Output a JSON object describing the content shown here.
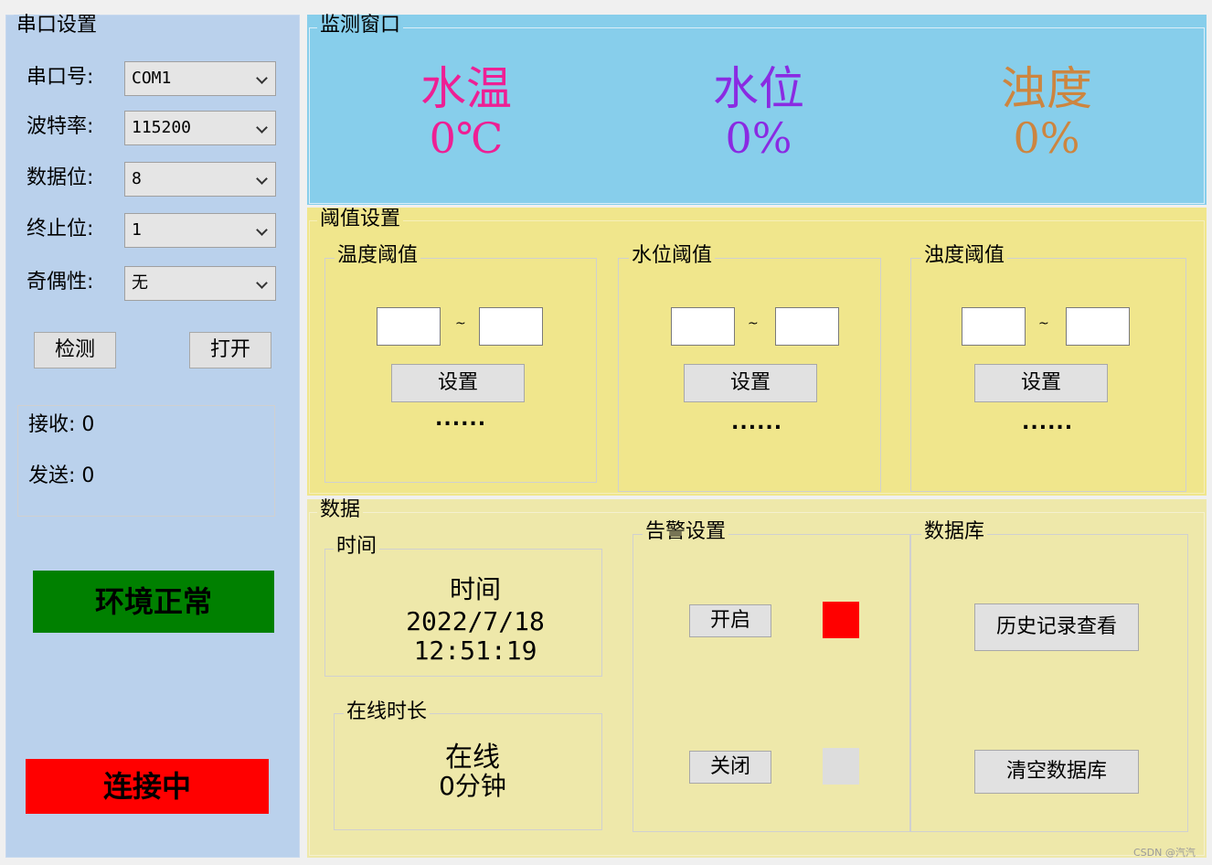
{
  "serial": {
    "title": "串口设置",
    "fields": [
      {
        "label": "串口号:",
        "value": "COM1"
      },
      {
        "label": "波特率:",
        "value": "115200"
      },
      {
        "label": "数据位:",
        "value": "8"
      },
      {
        "label": "终止位:",
        "value": "1"
      },
      {
        "label": "奇偶性:",
        "value": "无"
      }
    ],
    "detect_label": "检测",
    "open_label": "打开",
    "receive_text": "接收: 0",
    "send_text": "发送: 0",
    "env_status": "环境正常",
    "conn_status": "连接中",
    "colors": {
      "panel": "#bad1ec",
      "env_status_bg": "#008000",
      "conn_status_bg": "#ff0000"
    }
  },
  "monitor": {
    "title": "监测窗口",
    "items": [
      {
        "name": "水温",
        "value": "0℃",
        "color": "#ee1f94"
      },
      {
        "name": "水位",
        "value": "0%",
        "color": "#8a2be2"
      },
      {
        "name": "浊度",
        "value": "0%",
        "color": "#cd853f"
      }
    ],
    "bg_color": "#87ceeb"
  },
  "threshold": {
    "title": "阈值设置",
    "groups": [
      {
        "title": "温度阈值",
        "separator": "~",
        "set_label": "设置",
        "status": "......"
      },
      {
        "title": "水位阈值",
        "separator": "~",
        "set_label": "设置",
        "status": "......"
      },
      {
        "title": "浊度阈值",
        "separator": "~",
        "set_label": "设置",
        "status": "......"
      }
    ],
    "bg_color": "#f0e68c"
  },
  "data": {
    "title": "数据",
    "time_group": {
      "title": "时间",
      "heading": "时间",
      "date": "2022/7/18",
      "time": "12:51:19"
    },
    "online_group": {
      "title": "在线时长",
      "heading": "在线",
      "duration": "0分钟"
    },
    "alarm": {
      "title": "告警设置",
      "on_label": "开启",
      "off_label": "关闭",
      "on_color": "#ff0000",
      "off_color": "#dddddd"
    },
    "database": {
      "title": "数据库",
      "history_label": "历史记录查看",
      "clear_label": "清空数据库"
    },
    "bg_color": "#eee8aa"
  },
  "watermark": "CSDN @汽汽"
}
